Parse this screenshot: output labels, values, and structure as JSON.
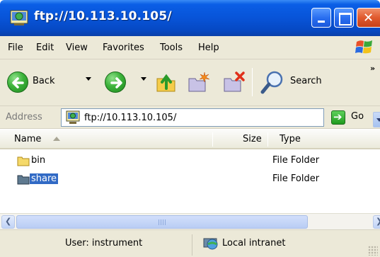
{
  "window": {
    "title": "ftp://10.113.10.105/",
    "controls": [
      "minimize",
      "maximize",
      "close"
    ]
  },
  "menu": {
    "items": [
      "File",
      "Edit",
      "View",
      "Favorites",
      "Tools",
      "Help"
    ]
  },
  "toolbar": {
    "back_label": "Back",
    "search_label": "Search",
    "overflow_label": "»",
    "icons": [
      "back-arrow-icon",
      "forward-arrow-icon",
      "up-folder-icon",
      "new-folder-icon",
      "delete-icon",
      "search-icon"
    ]
  },
  "address": {
    "label": "Address",
    "value": "ftp://10.113.10.105/",
    "go_label": "Go"
  },
  "columns": {
    "name": "Name",
    "size": "Size",
    "type": "Type"
  },
  "files": [
    {
      "name": "bin",
      "size": "",
      "type": "File Folder",
      "selected": false
    },
    {
      "name": "share",
      "size": "",
      "type": "File Folder",
      "selected": true
    }
  ],
  "status": {
    "user": "User: instrument",
    "zone": "Local intranet"
  },
  "colors": {
    "title_bar": "#0854d8",
    "selection": "#316ac5",
    "chrome": "#ece9d8"
  }
}
